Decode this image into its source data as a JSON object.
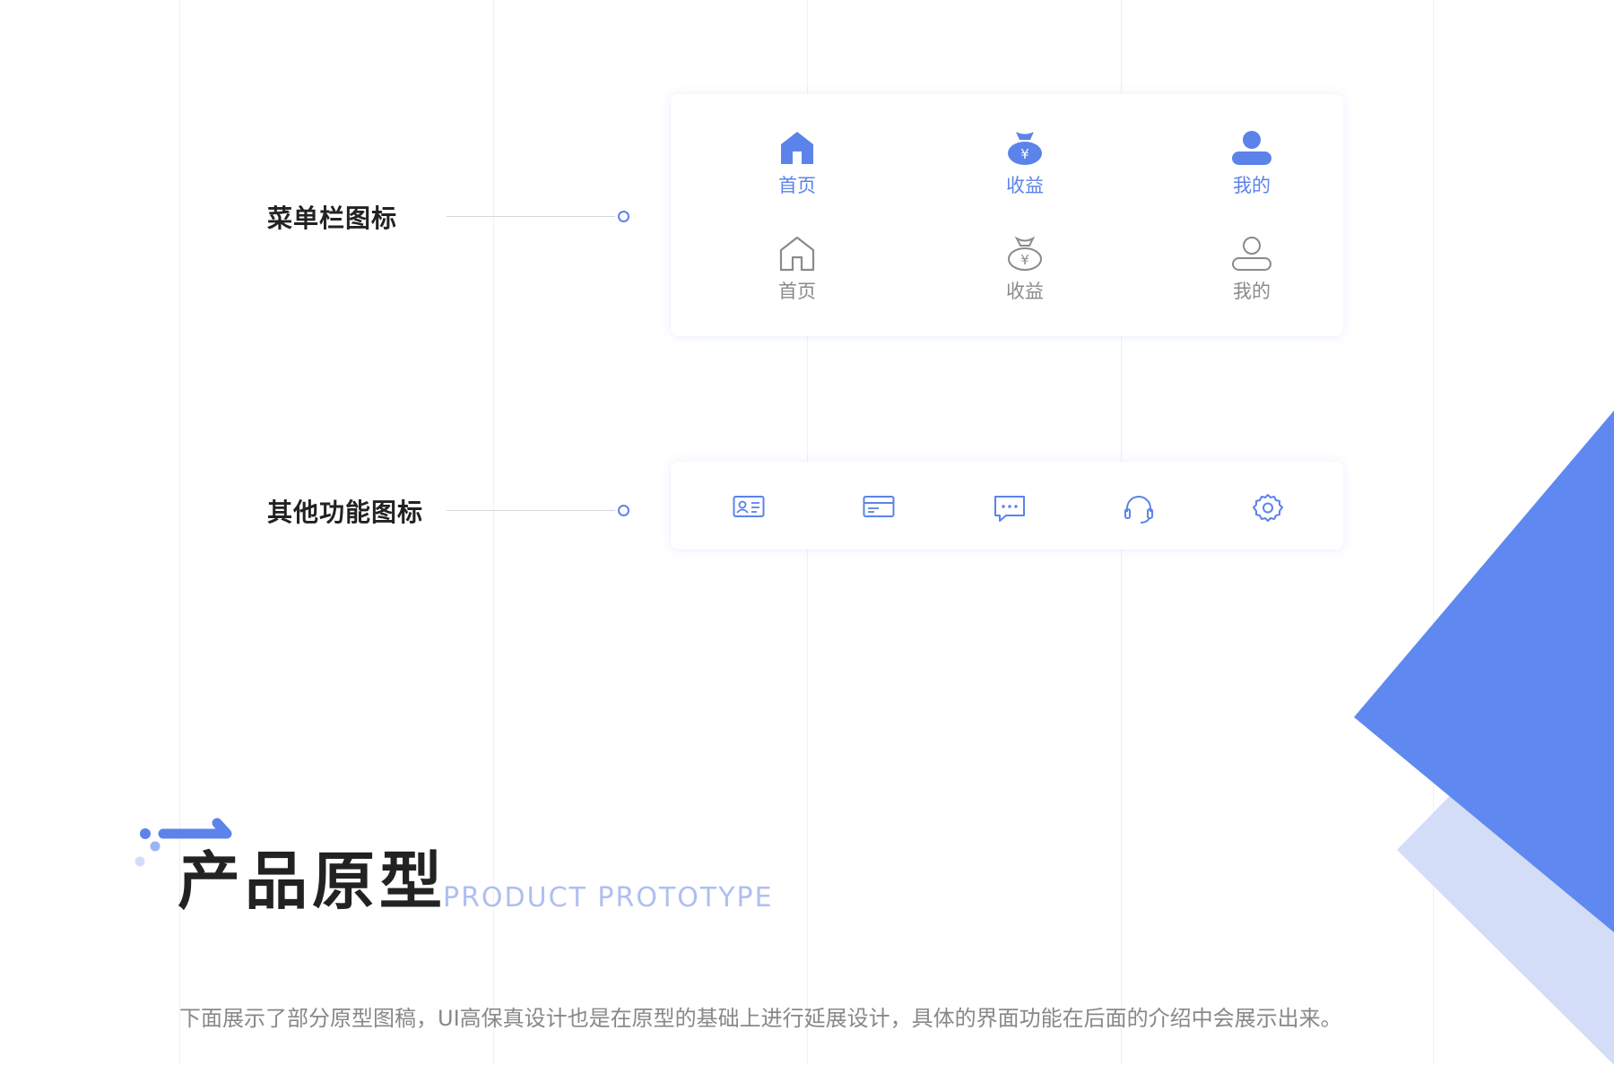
{
  "sections": {
    "menu_icons_label": "菜单栏图标",
    "other_icons_label": "其他功能图标"
  },
  "menu_bar": {
    "active": [
      {
        "label": "首页",
        "icon": "home-filled-icon"
      },
      {
        "label": "收益",
        "icon": "money-bag-filled-icon"
      },
      {
        "label": "我的",
        "icon": "user-filled-icon"
      }
    ],
    "inactive": [
      {
        "label": "首页",
        "icon": "home-outline-icon"
      },
      {
        "label": "收益",
        "icon": "money-bag-outline-icon"
      },
      {
        "label": "我的",
        "icon": "user-outline-icon"
      }
    ]
  },
  "function_icons": [
    "id-card-icon",
    "bank-card-icon",
    "message-icon",
    "headset-icon",
    "settings-icon"
  ],
  "prototype": {
    "title": "产品原型",
    "subtitle": "PRODUCT PROTOTYPE",
    "description": "下面展示了部分原型图稿，UI高保真设计也是在原型的基础上进行延展设计，具体的界面功能在后面的介绍中会展示出来。"
  },
  "colors": {
    "accent": "#5b83ea",
    "accent_light": "#d4ddf8",
    "inactive": "#8a8a8a"
  }
}
